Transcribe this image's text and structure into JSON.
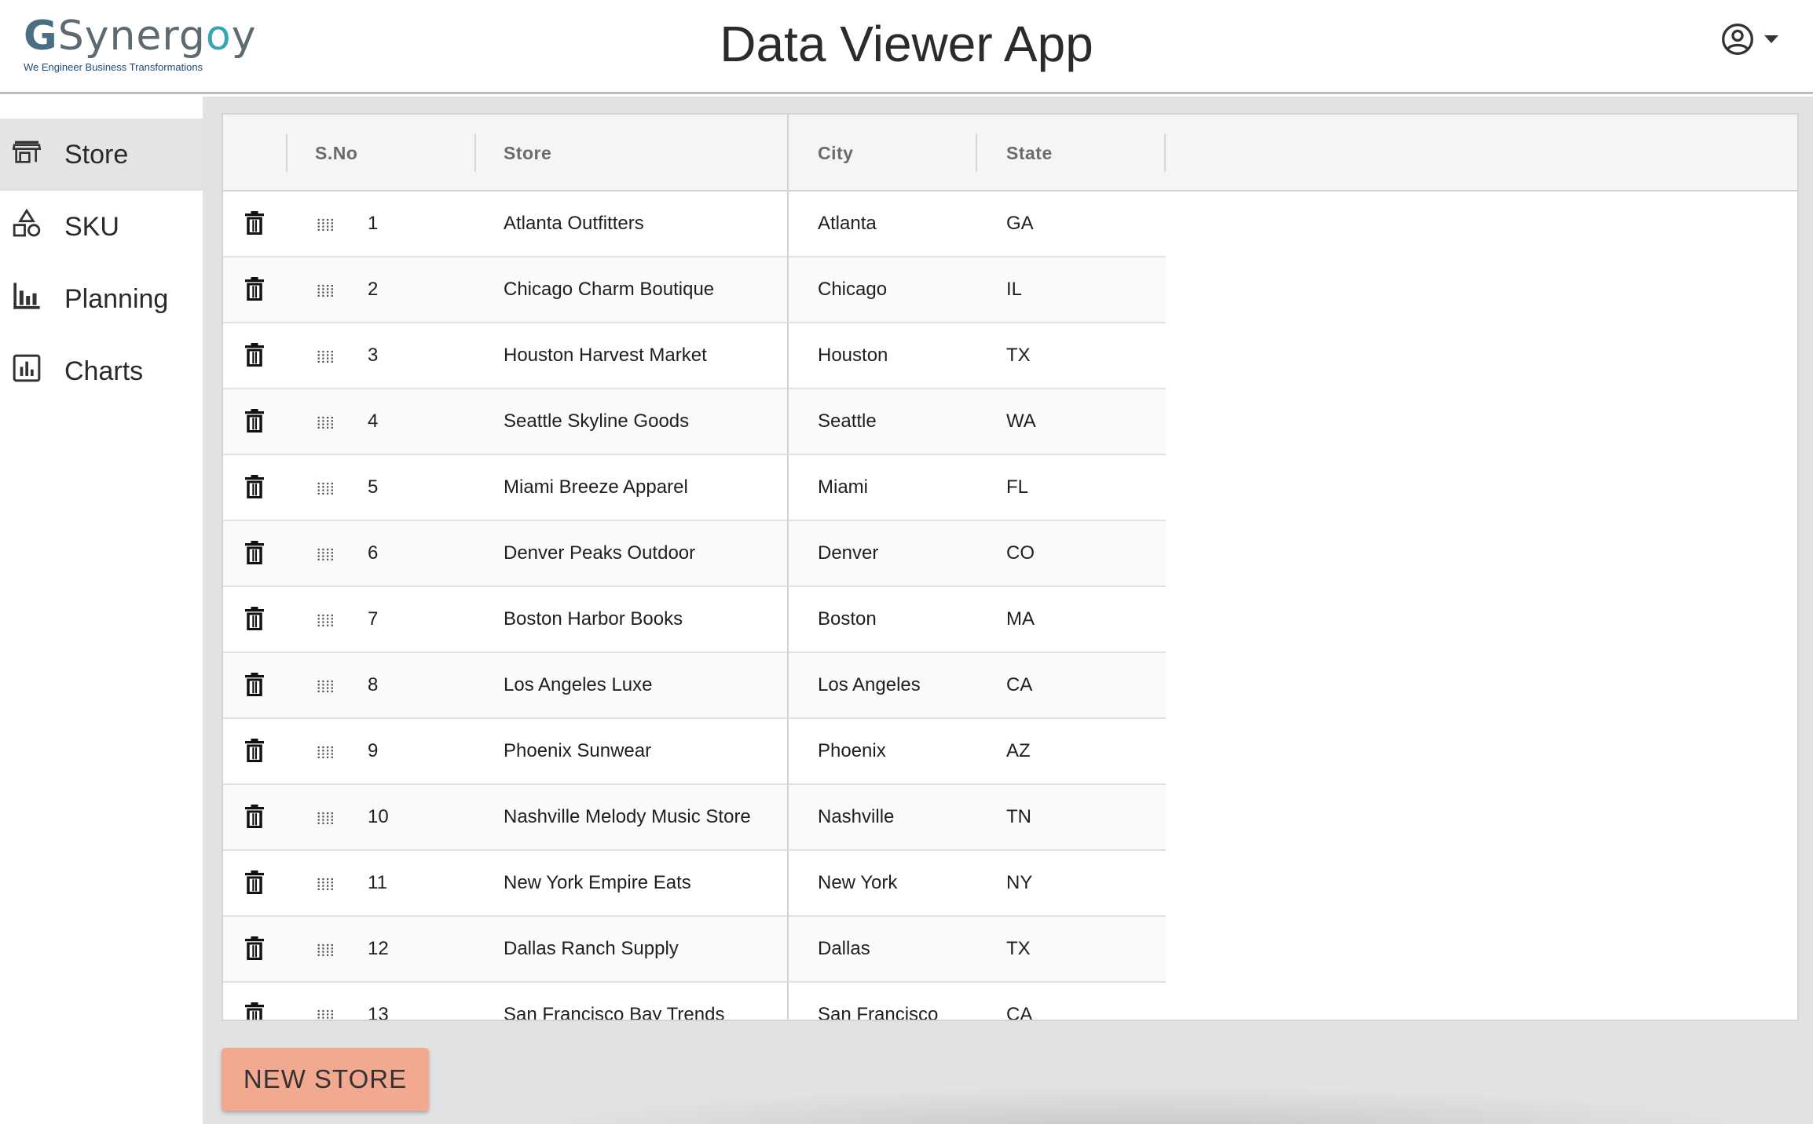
{
  "header": {
    "logo_text_g": "G",
    "logo_text_rest_a": "Synerg",
    "logo_text_rest_o": "o",
    "logo_text_rest_b": "y",
    "logo_tagline": "We Engineer Business Transformations",
    "title": "Data Viewer App",
    "account_icon": "account-circle-icon"
  },
  "sidebar": {
    "items": [
      {
        "label": "Store",
        "icon": "store-icon",
        "active": true
      },
      {
        "label": "SKU",
        "icon": "shapes-icon",
        "active": false
      },
      {
        "label": "Planning",
        "icon": "bar-chart-icon",
        "active": false
      },
      {
        "label": "Charts",
        "icon": "chart-box-icon",
        "active": false
      }
    ]
  },
  "grid": {
    "columns": [
      "S.No",
      "Store",
      "City",
      "State"
    ],
    "rows": [
      {
        "sno": "1",
        "store": "Atlanta Outfitters",
        "city": "Atlanta",
        "state": "GA"
      },
      {
        "sno": "2",
        "store": "Chicago Charm Boutique",
        "city": "Chicago",
        "state": "IL"
      },
      {
        "sno": "3",
        "store": "Houston Harvest Market",
        "city": "Houston",
        "state": "TX"
      },
      {
        "sno": "4",
        "store": "Seattle Skyline Goods",
        "city": "Seattle",
        "state": "WA"
      },
      {
        "sno": "5",
        "store": "Miami Breeze Apparel",
        "city": "Miami",
        "state": "FL"
      },
      {
        "sno": "6",
        "store": "Denver Peaks Outdoor",
        "city": "Denver",
        "state": "CO"
      },
      {
        "sno": "7",
        "store": "Boston Harbor Books",
        "city": "Boston",
        "state": "MA"
      },
      {
        "sno": "8",
        "store": "Los Angeles Luxe",
        "city": "Los Angeles",
        "state": "CA"
      },
      {
        "sno": "9",
        "store": "Phoenix Sunwear",
        "city": "Phoenix",
        "state": "AZ"
      },
      {
        "sno": "10",
        "store": "Nashville Melody Music Store",
        "city": "Nashville",
        "state": "TN"
      },
      {
        "sno": "11",
        "store": "New York Empire Eats",
        "city": "New York",
        "state": "NY"
      },
      {
        "sno": "12",
        "store": "Dallas Ranch Supply",
        "city": "Dallas",
        "state": "TX"
      },
      {
        "sno": "13",
        "store": "San Francisco Bay Trends",
        "city": "San Francisco",
        "state": "CA"
      }
    ],
    "row_icons": {
      "delete": "trash-icon",
      "drag": "drag-handle-icon"
    }
  },
  "actions": {
    "new_store_label": "NEW STORE"
  },
  "colors": {
    "accent_button": "#f2a98f",
    "sidebar_active": "#e4e4e4",
    "main_bg": "#e2e2e2",
    "header_bg": "#f4f5f5"
  }
}
